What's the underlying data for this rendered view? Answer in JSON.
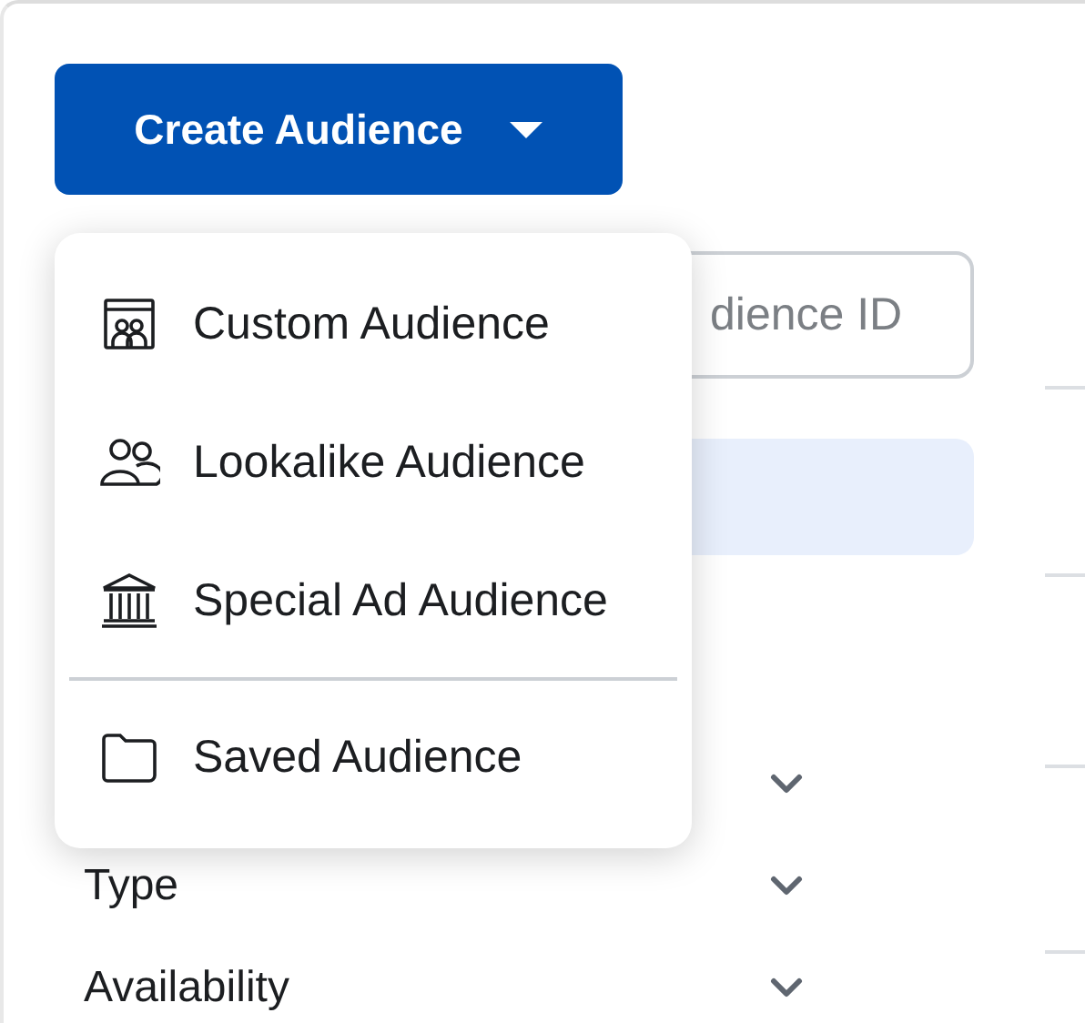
{
  "create_button": {
    "label": "Create Audience"
  },
  "search": {
    "placeholder": "dience ID"
  },
  "menu": {
    "items": [
      {
        "kind": "custom",
        "label": "Custom Audience"
      },
      {
        "kind": "lookalike",
        "label": "Lookalike Audience"
      },
      {
        "kind": "special",
        "label": "Special Ad Audience"
      },
      {
        "kind": "divider"
      },
      {
        "kind": "saved",
        "label": "Saved Audience"
      }
    ]
  },
  "filters": [
    {
      "expanded": false
    },
    {
      "label": "Type",
      "expanded": false
    },
    {
      "label": "Availability",
      "expanded": false
    }
  ]
}
